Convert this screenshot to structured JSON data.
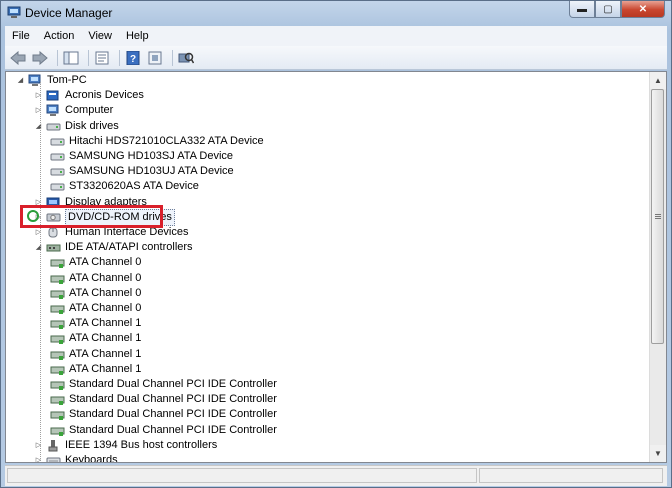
{
  "window": {
    "title": "Device Manager"
  },
  "caption_buttons": {
    "minimize": "▬",
    "maximize": "▢",
    "close": "✕"
  },
  "menu": [
    "File",
    "Action",
    "View",
    "Help"
  ],
  "toolbar": [
    "back-arrow-icon",
    "forward-arrow-icon",
    "show-hide-console-tree-icon",
    "properties-icon",
    "help-icon",
    "scan-hardware-icon"
  ],
  "tree": {
    "root": "Tom-PC",
    "categories": [
      {
        "label": "Acronis Devices",
        "icon": "acronis-device-icon",
        "expanded": false
      },
      {
        "label": "Computer",
        "icon": "computer-icon",
        "expanded": false
      },
      {
        "label": "Disk drives",
        "icon": "disk-drive-icon",
        "expanded": true,
        "children": [
          "Hitachi HDS721010CLA332 ATA Device",
          "SAMSUNG HD103SJ ATA Device",
          "SAMSUNG HD103UJ ATA Device",
          "ST3320620AS ATA Device"
        ]
      },
      {
        "label": "Display adapters",
        "icon": "display-adapter-icon",
        "expanded": false
      },
      {
        "label": "DVD/CD-ROM drives",
        "icon": "dvd-drive-icon",
        "expanded": false,
        "selected": true
      },
      {
        "label": "Human Interface Devices",
        "icon": "hid-icon",
        "expanded": false
      },
      {
        "label": "IDE ATA/ATAPI controllers",
        "icon": "ide-controller-icon",
        "expanded": true,
        "children": [
          "ATA Channel 0",
          "ATA Channel 0",
          "ATA Channel 0",
          "ATA Channel 0",
          "ATA Channel 1",
          "ATA Channel 1",
          "ATA Channel 1",
          "ATA Channel 1",
          "Standard Dual Channel PCI IDE Controller",
          "Standard Dual Channel PCI IDE Controller",
          "Standard Dual Channel PCI IDE Controller",
          "Standard Dual Channel PCI IDE Controller"
        ]
      },
      {
        "label": "IEEE 1394 Bus host controllers",
        "icon": "ieee1394-icon",
        "expanded": false
      },
      {
        "label": "Keyboards",
        "icon": "keyboard-icon",
        "expanded": false
      }
    ]
  },
  "colors": {
    "highlight": "#d9202b",
    "circle": "#2a9c3a",
    "window_frame": "#aac2de"
  }
}
